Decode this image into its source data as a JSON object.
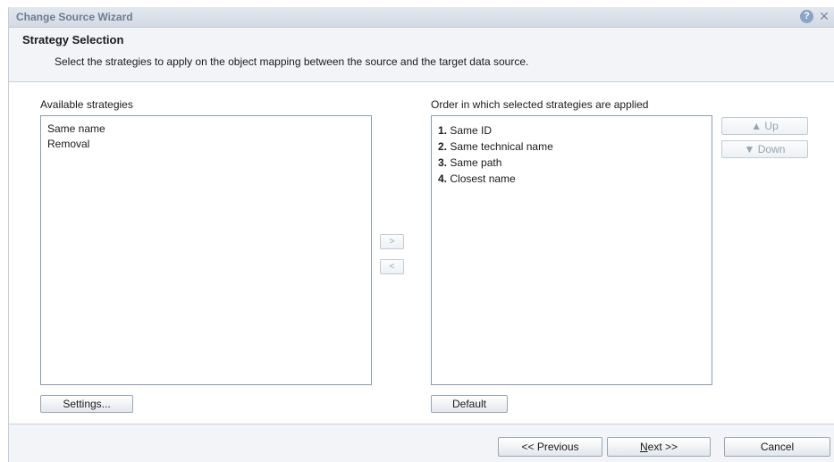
{
  "window": {
    "title": "Change Source Wizard",
    "help_icon": "?",
    "close_icon": "✕"
  },
  "header": {
    "title": "Strategy Selection",
    "description": "Select the strategies to apply on the object mapping between the source and the target data source."
  },
  "available": {
    "label": "Available strategies",
    "items": [
      "Same name",
      "Removal"
    ]
  },
  "selected": {
    "label": "Order in which selected strategies are applied",
    "items": [
      {
        "num": "1.",
        "text": "Same ID"
      },
      {
        "num": "2.",
        "text": "Same technical name"
      },
      {
        "num": "3.",
        "text": "Same path"
      },
      {
        "num": "4.",
        "text": "Closest name"
      }
    ]
  },
  "buttons": {
    "add": ">",
    "remove": "<",
    "up": "▲ Up",
    "down": "▼ Down",
    "settings": "Settings...",
    "default": "Default",
    "previous": "<< Previous",
    "next_mnemonic": "N",
    "next_rest": "ext >>",
    "cancel": "Cancel"
  },
  "colors": {
    "title_text": "#6d7c91",
    "header_bg": "#f2f4f7",
    "list_border": "#8c9bb0",
    "help_icon": "#8aa4c8"
  },
  "icons": {
    "help": "help-icon",
    "close": "close-icon",
    "up_arrow": "triangle-up-icon",
    "down_arrow": "triangle-down-icon"
  }
}
